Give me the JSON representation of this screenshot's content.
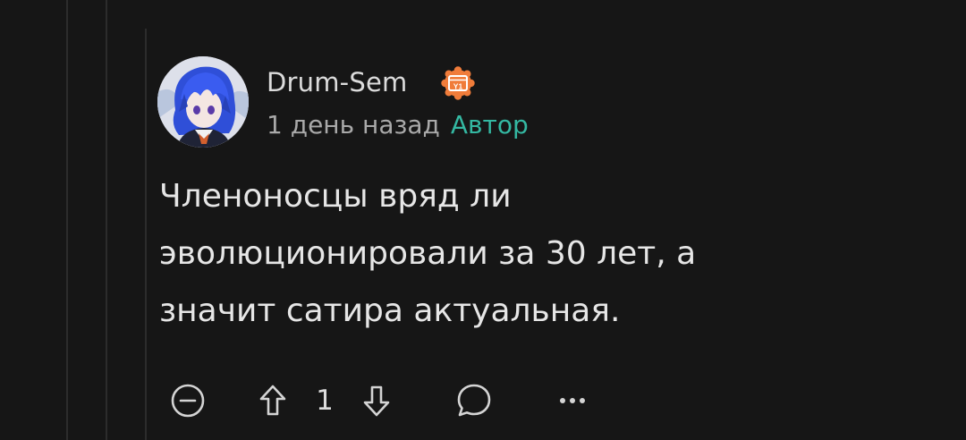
{
  "comment": {
    "username": "Drum-Sem",
    "badge_text": "Y1",
    "time": "1 день назад",
    "author_tag": "Автор",
    "lines": [
      "Членоносцы вряд ли",
      "эволюционировали за 30 лет, а",
      "значит сатира актуальная."
    ],
    "score": "1"
  },
  "icons": {
    "collapse": "minus-circle-icon",
    "upvote": "arrow-up-icon",
    "downvote": "arrow-down-icon",
    "reply": "speech-bubble-icon",
    "more": "ellipsis-icon"
  },
  "colors": {
    "background": "#161616",
    "text": "#e6e6e6",
    "secondary": "#a9a9a9",
    "author_tag": "#34b8a2",
    "badge": "#f07c3a"
  }
}
